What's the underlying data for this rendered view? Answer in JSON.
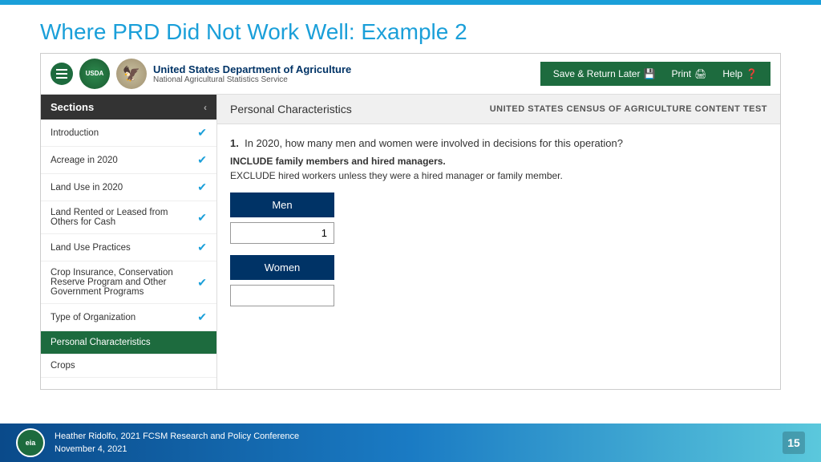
{
  "slide": {
    "top_bar_color": "#1a9fd9",
    "title": "Where PRD Did Not Work Well: Example 2"
  },
  "usda_header": {
    "hamburger_label": "menu",
    "org_name": "United States Department of Agriculture",
    "org_sub": "National Agricultural Statistics Service",
    "save_btn": "Save & Return Later",
    "print_btn": "Print",
    "help_btn": "Help"
  },
  "sidebar": {
    "header_label": "Sections",
    "items": [
      {
        "label": "Introduction",
        "completed": true,
        "active": false
      },
      {
        "label": "Acreage in 2020",
        "completed": true,
        "active": false
      },
      {
        "label": "Land Use in 2020",
        "completed": true,
        "active": false
      },
      {
        "label": "Land Rented or Leased from Others for Cash",
        "completed": true,
        "active": false
      },
      {
        "label": "Land Use Practices",
        "completed": true,
        "active": false
      },
      {
        "label": "Crop Insurance, Conservation Reserve Program and Other Government Programs",
        "completed": true,
        "active": false
      },
      {
        "label": "Type of Organization",
        "completed": true,
        "active": false
      },
      {
        "label": "Personal Characteristics",
        "completed": false,
        "active": true
      },
      {
        "label": "Crops",
        "completed": false,
        "active": false
      }
    ]
  },
  "survey": {
    "section_title": "Personal Characteristics",
    "banner": "UNITED STATES CENSUS OF AGRICULTURE CONTENT TEST",
    "question_number": "1.",
    "question_text": "In 2020, how many men and women were involved in decisions for this operation?",
    "note1": "INCLUDE family members and hired managers.",
    "note2": "EXCLUDE hired workers unless they were a hired manager or family member.",
    "men_label": "Men",
    "men_value": "1",
    "women_label": "Women",
    "women_value": ""
  },
  "footer": {
    "logo_text": "eia",
    "presenter": "Heather Ridolfo, 2021 FCSM Research and Policy Conference",
    "date": "November 4, 2021",
    "slide_number": "15"
  }
}
